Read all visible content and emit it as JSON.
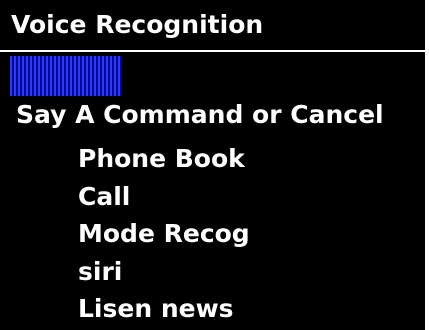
{
  "title": "Voice Recognition",
  "progress": {
    "level": 0.33,
    "color": "#2b38ff"
  },
  "prompt": "Say A Command or Cancel",
  "commands": [
    "Phone Book",
    "Call",
    "Mode Recog",
    "siri",
    "Lisen news"
  ],
  "colors": {
    "background": "#000000",
    "text": "#ffffff",
    "accent": "#2b38ff"
  }
}
